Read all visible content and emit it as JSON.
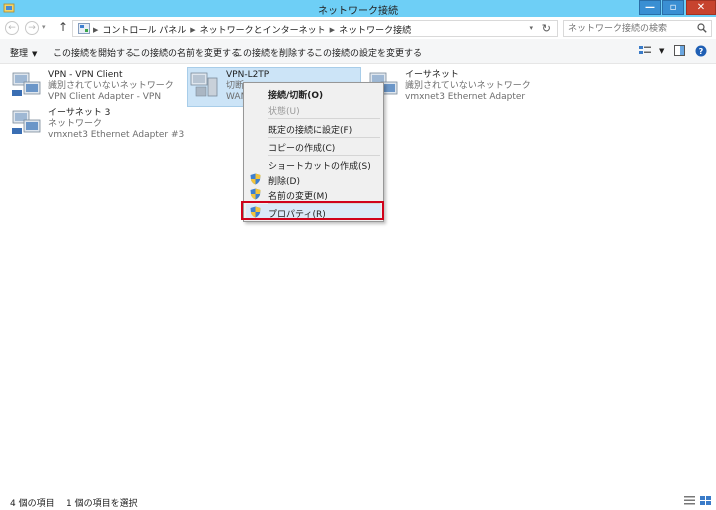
{
  "window": {
    "title": "ネットワーク接続",
    "min_label": "—",
    "max_label": "▫",
    "close_label": "✕"
  },
  "address": {
    "breadcrumbs": [
      "コントロール パネル",
      "ネットワークとインターネット",
      "ネットワーク接続"
    ],
    "search_placeholder": "ネットワーク接続の検索"
  },
  "toolbar": {
    "organize_label": "整理",
    "commands": [
      "この接続を開始する",
      "この接続の名前を変更する",
      "この接続を削除する",
      "この接続の設定を変更する"
    ]
  },
  "connections": [
    {
      "name": "VPN - VPN Client",
      "status": "識別されていないネットワーク",
      "adapter": "VPN Client Adapter - VPN"
    },
    {
      "name": "VPN-L2TP",
      "status": "切断",
      "adapter": "WAN"
    },
    {
      "name": "イーサネット",
      "status": "識別されていないネットワーク",
      "adapter": "vmxnet3 Ethernet Adapter"
    },
    {
      "name": "イーサネット 3",
      "status": "ネットワーク",
      "adapter": "vmxnet3 Ethernet Adapter #3"
    }
  ],
  "context_menu": {
    "connect": "接続/切断(O)",
    "status": "状態(U)",
    "set_default": "既定の接続に設定(F)",
    "copy": "コピーの作成(C)",
    "shortcut": "ショートカットの作成(S)",
    "delete": "削除(D)",
    "rename": "名前の変更(M)",
    "properties": "プロパティ(R)"
  },
  "statusbar": {
    "item_count": "4 個の項目",
    "selected_count": "1 個の項目を選択"
  },
  "colors": {
    "titlebar": "#6ecff6",
    "close_button": "#c7432e",
    "selection": "#cce4f7",
    "highlight": "#d0021b"
  }
}
